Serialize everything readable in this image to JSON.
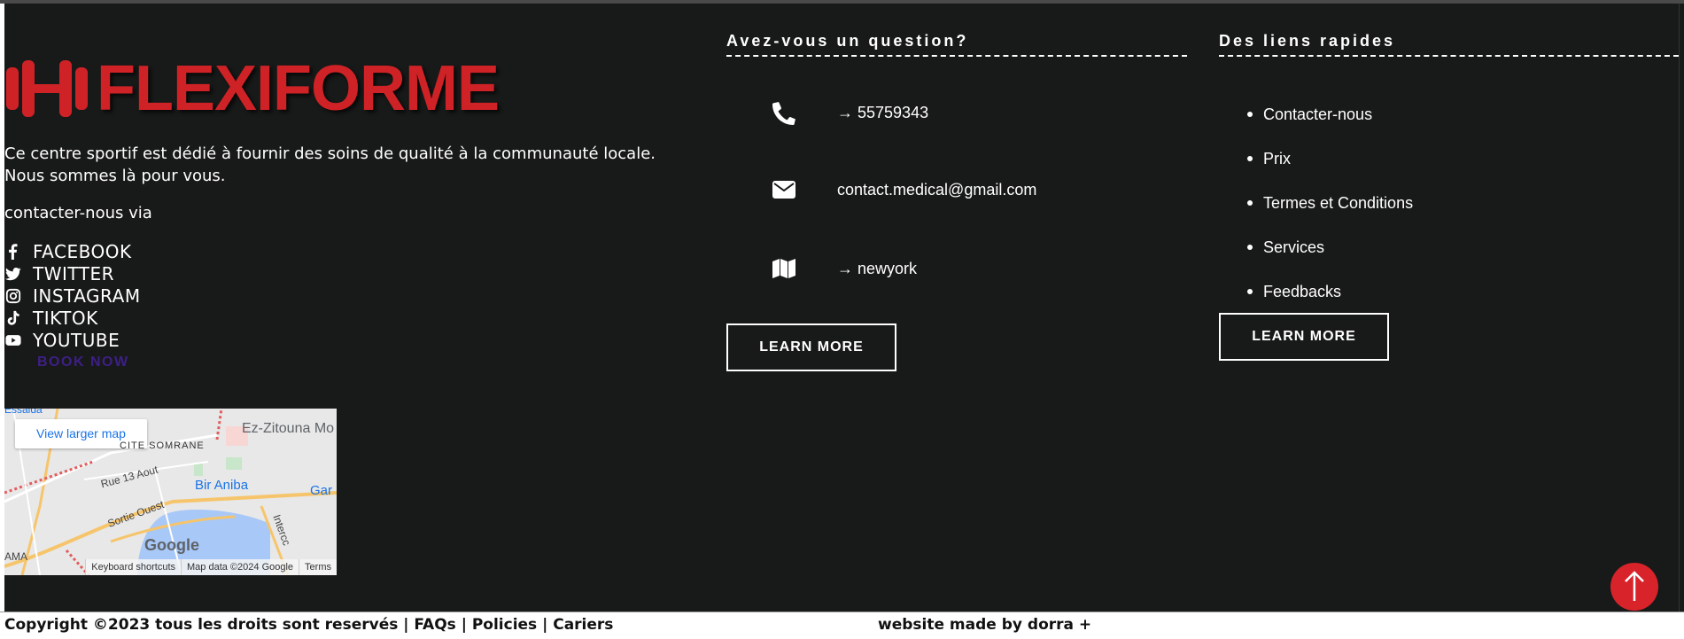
{
  "brand": {
    "name": "FLEXIFORME",
    "icon": "dumbbell-icon",
    "color": "#cf2226"
  },
  "about": {
    "text": "Ce centre sportif est dédié à fournir des soins de qualité à la communauté locale. Nous sommes là pour vous.",
    "contact_via": "contacter-nous via"
  },
  "social": [
    {
      "label": "FACEBOOK",
      "icon": "facebook-icon"
    },
    {
      "label": "TWITTER",
      "icon": "twitter-icon"
    },
    {
      "label": "INSTAGRAM",
      "icon": "instagram-icon"
    },
    {
      "label": "TIKTOK",
      "icon": "tiktok-icon"
    },
    {
      "label": "YOUTUBE",
      "icon": "youtube-icon"
    }
  ],
  "book_now": "BOOK NOW",
  "map": {
    "button": "View larger map",
    "labels": [
      "Ez-Zitouna Mo",
      "CITE SOMRANE",
      "Rue 13 Aout",
      "Bir Aniba",
      "Sortie Ouest",
      "Gar",
      "Intercc",
      "AMA",
      "Essaida"
    ],
    "google": "Google",
    "footer": [
      "Keyboard shortcuts",
      "Map data ©2024 Google",
      "Terms"
    ]
  },
  "question": {
    "title": "Avez-vous un question?",
    "phone": "→ 55759343",
    "email": "contact.medical@gmail.com",
    "address": "→ newyork",
    "button": "LEARN MORE"
  },
  "quick_links": {
    "title": "Des liens rapides",
    "items": [
      "Contacter-nous",
      "Prix",
      "Termes et Conditions",
      "Services",
      "Feedbacks"
    ],
    "button": "LEARN MORE"
  },
  "bottom": {
    "copyright": "Copyright ©2023 tous les droits sont reservés | FAQs | Policies | Cariers",
    "made_by": "website made by dorra +"
  },
  "colors": {
    "background": "#181a19",
    "accent": "#cf2226",
    "book_now": "#3e1f86"
  }
}
